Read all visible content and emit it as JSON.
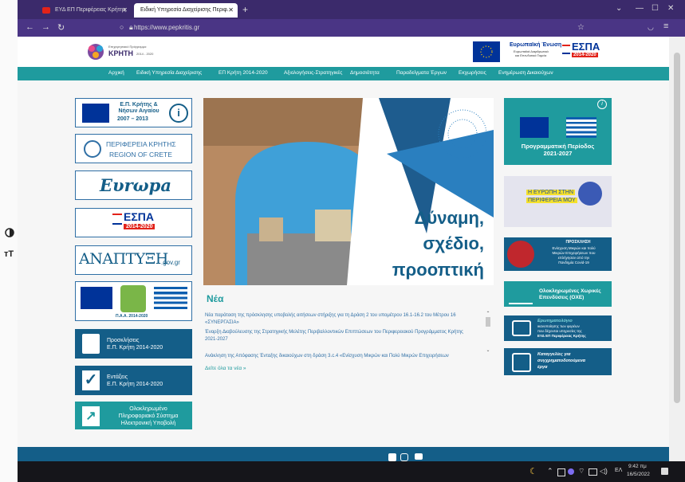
{
  "browser": {
    "tabs": [
      {
        "label": "ΕΥΔ ΕΠ Περιφέρειας Κρήτης",
        "fav": "#e2231a"
      },
      {
        "label": "Ειδική Υπηρεσία Διαχείρισης Περιφ.",
        "fav": "#1f9b9e"
      }
    ],
    "url": "https://www.pepkritis.gr"
  },
  "header": {
    "logo_line1": "Επιχειρησιακό Πρόγραμμα",
    "logo_title": "ΚΡΗΤΗ",
    "logo_years": "2014 - 2020",
    "eu_title": "Ευρωπαϊκή Ένωση",
    "eu_sub1": "Ευρωπαϊκά Διαρθρωτικά",
    "eu_sub2": "και Επενδυτικά Ταμεία",
    "espa": "ΕΣΠΑ",
    "espa_years": "2014-2020"
  },
  "menu": [
    "Αρχική",
    "Ειδική Υπηρεσία Διαχείρισης",
    "ΕΠ Κρήτη 2014-2020",
    "Αξιολογήσεις-Στρατηγικές",
    "Δημοσιότητα",
    "Παραδείγματα Έργων",
    "Εκχωρήσεις",
    "Ενημέρωση Δικαιούχων"
  ],
  "left_logos": {
    "ep_title": "Ε.Π. Κρήτης & Νήσων Αιγαίου",
    "ep_years": "2007 – 2013",
    "region_gr": "ΠΕΡΙΦΕΡΕΙΑ ΚΡΗΤΗΣ",
    "region_en": "REGION OF CRETE",
    "europa": "Ευrωpa",
    "espa": "ΕΣΠΑ",
    "espa_years": "2014-2020",
    "anaptyxi": "ΑΝΑΠΤΥΞΗ",
    "anaptyxi_suffix": ".gov.gr",
    "paa": "Π.Α.Α. 2014-2020"
  },
  "left_buttons": [
    {
      "line1": "Προσκλήσεις",
      "line2": "Ε.Π. Κρήτη 2014-2020"
    },
    {
      "line1": "Εντάξεις",
      "line2": "Ε.Π. Κρήτη 2014-2020"
    },
    {
      "line1": "Ολοκληρωμένο",
      "line2": "Πληροφοριακό Σύστημα",
      "line3": "Ηλεκτρονική Υποβολή"
    }
  ],
  "hero": {
    "line1": "Δύναμη,",
    "line2": "σχέδιο,",
    "line3": "προοπτική"
  },
  "news": {
    "title": "Νέα",
    "items": [
      "Νέα παράταση της πρόσκλησης υποβολής αιτήσεων στήριξης για τη Δράση 2 του υπομέτρου 16.1-16.2 του Μέτρου 16 «ΣΥΝΕΡΓΑΣΙΑ»",
      "Έναρξη Διαβούλευσης της Στρατηγικής Μελέτης Περιβαλλοντικών Επιπτώσεων του Περιφερειακού Προγράμματος Κρήτης 2021-2027",
      "Ανάκληση της Απόφασης Ένταξης δικαιούχων στη δράση 3.c.4 «Ενίσχυση Μικρών και Πολύ Μικρών Επιχειρήσεων"
    ],
    "see_all": "Δείτε όλα τα νέα »"
  },
  "right": {
    "period": "Προγραμματική Περίοδος 2021-2027",
    "europe_line1": "Η ΕΥΡΩΠΗ ΣΤΗΝ",
    "europe_line2": "ΠΕΡΙΦΕΡΕΙΑ ΜΟΥ",
    "call_title": "ΠΡΟΣΚΛΗΣΗ",
    "call_line1": "Ενίσχυση Μικρών και πολύ",
    "call_line2": "Μικρών Επιχειρήσεων που",
    "call_line3": "επλήγησαν από την",
    "call_line4": "Πανδημία Covid-19",
    "oxe_line1": "Ολοκληρωμένες Χωρικές",
    "oxe_line2": "Επενδύσεις (ΟΧΕ)",
    "q_title": "Ερωτηματολόγιο",
    "q_line1": "ικανοποίησης των φορέων",
    "q_line2": "που δέχονται υπηρεσίες της",
    "q_line3": "ΕΥΔ ΕΠ Περιφέρειας Κρήτης",
    "report_line1": "Καταγγελίες για",
    "report_line2": "συγχρηματοδοτούμενα",
    "report_line3": "έργα"
  },
  "taskbar": {
    "lang": "ΕΛ",
    "time": "9:42 πμ",
    "date": "16/5/2022"
  },
  "colors": {
    "purple": "#3b2a6b",
    "teal": "#1f9b9e",
    "navy": "#145e88"
  }
}
